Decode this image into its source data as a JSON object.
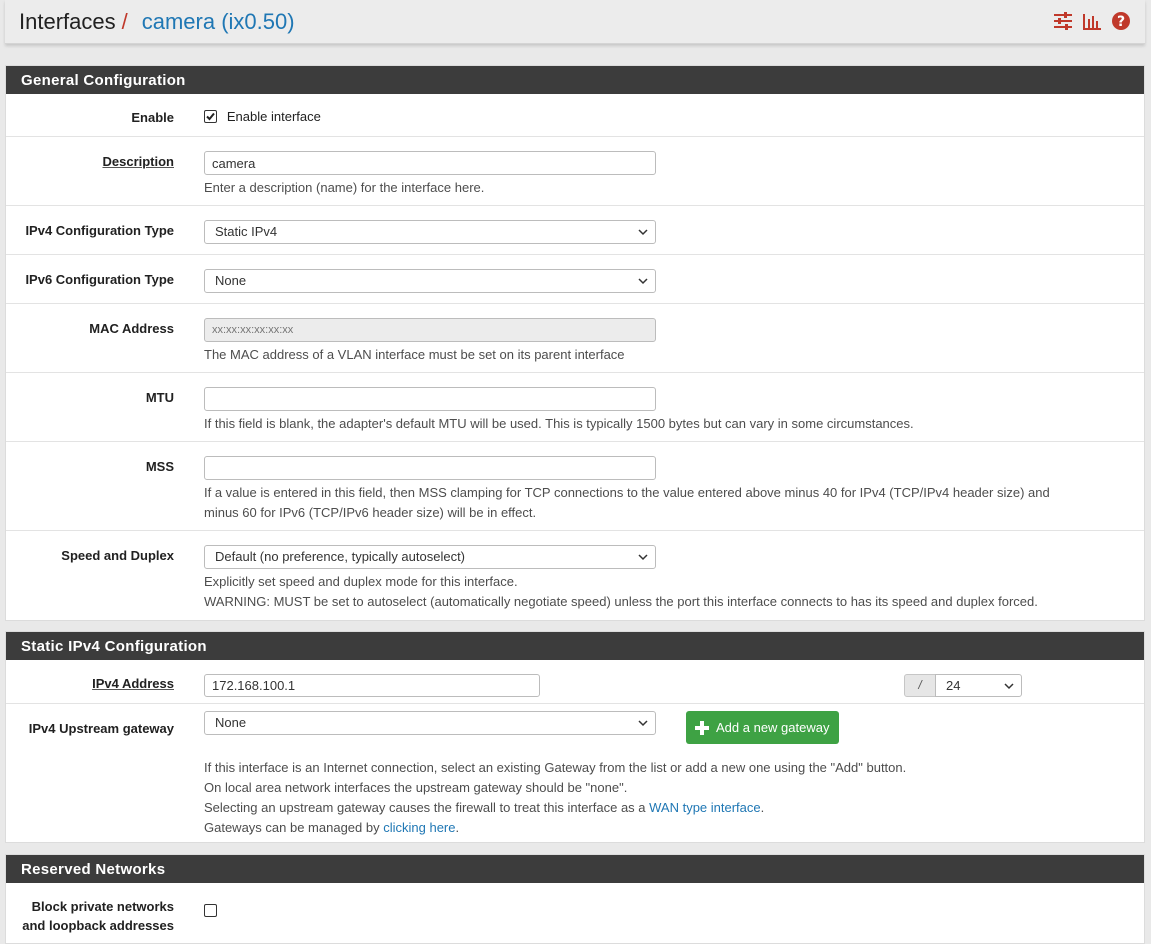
{
  "header": {
    "breadcrumb_root": "Interfaces",
    "breadcrumb_sep": "/",
    "breadcrumb_current": "camera (ix0.50)",
    "icons": [
      "sliders-icon",
      "bar-chart-icon",
      "help-icon"
    ],
    "icon_color": "#c0392b"
  },
  "general": {
    "title": "General Configuration",
    "enable": {
      "label": "Enable",
      "checkbox_label": "Enable interface",
      "checked": true
    },
    "description": {
      "label": "Description",
      "value": "camera",
      "help": "Enter a description (name) for the interface here."
    },
    "ipv4_type": {
      "label": "IPv4 Configuration Type",
      "value": "Static IPv4"
    },
    "ipv6_type": {
      "label": "IPv6 Configuration Type",
      "value": "None"
    },
    "mac": {
      "label": "MAC Address",
      "placeholder": "xx:xx:xx:xx:xx:xx",
      "help": "The MAC address of a VLAN interface must be set on its parent interface"
    },
    "mtu": {
      "label": "MTU",
      "value": "",
      "help": "If this field is blank, the adapter's default MTU will be used. This is typically 1500 bytes but can vary in some circumstances."
    },
    "mss": {
      "label": "MSS",
      "value": "",
      "help_line1": "If a value is entered in this field, then MSS clamping for TCP connections to the value entered above minus 40 for IPv4 (TCP/IPv4 header size) and",
      "help_line2": "minus 60 for IPv6 (TCP/IPv6 header size) will be in effect."
    },
    "speed": {
      "label": "Speed and Duplex",
      "value": "Default (no preference, typically autoselect)",
      "help_line1": "Explicitly set speed and duplex mode for this interface.",
      "help_line2": "WARNING: MUST be set to autoselect (automatically negotiate speed) unless the port this interface connects to has its speed and duplex forced."
    }
  },
  "static_ipv4": {
    "title": "Static IPv4 Configuration",
    "address": {
      "label": "IPv4 Address",
      "value": "172.168.100.1",
      "slash": "/",
      "mask": "24"
    },
    "gateway": {
      "label": "IPv4 Upstream gateway",
      "value": "None",
      "add_button": "Add a new gateway",
      "help_line1": "If this interface is an Internet connection, select an existing Gateway from the list or add a new one using the \"Add\" button.",
      "help_line2": "On local area network interfaces the upstream gateway should be \"none\".",
      "help_line3_pre": "Selecting an upstream gateway causes the firewall to treat this interface as a ",
      "help_line3_link": "WAN type interface",
      "help_line3_post": ".",
      "help_line4_pre": "Gateways can be managed by ",
      "help_line4_link": "clicking here",
      "help_line4_post": "."
    }
  },
  "reserved": {
    "title": "Reserved Networks",
    "block_private": {
      "label_line1": "Block private networks",
      "label_line2": "and loopback addresses",
      "checked": false
    }
  }
}
